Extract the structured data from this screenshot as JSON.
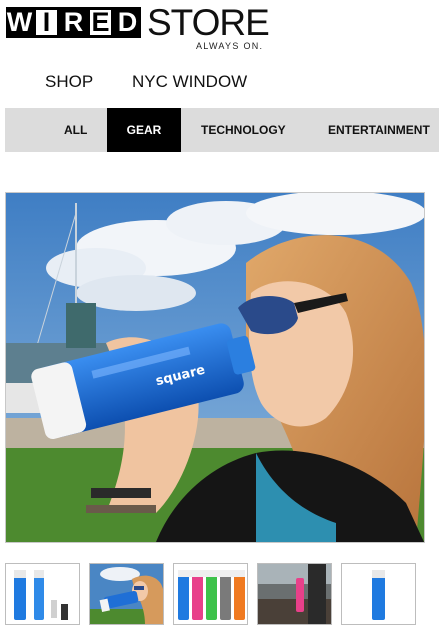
{
  "brand": {
    "logo_letters": [
      "W",
      "I",
      "R",
      "E",
      "D"
    ],
    "store": "STORE",
    "tagline": "ALWAYS ON."
  },
  "main_nav": [
    {
      "label": "SHOP"
    },
    {
      "label": "NYC WINDOW"
    }
  ],
  "category_tabs": [
    {
      "label": "ALL",
      "active": false
    },
    {
      "label": "GEAR",
      "active": true
    },
    {
      "label": "TECHNOLOGY",
      "active": false
    },
    {
      "label": "ENTERTAINMENT",
      "active": false
    }
  ],
  "product": {
    "bottle_brand": "square"
  },
  "thumbnails": [
    {
      "name": "bottles-lineup"
    },
    {
      "name": "woman-drinking"
    },
    {
      "name": "color-variants"
    },
    {
      "name": "bottle-outdoor"
    },
    {
      "name": "single-bottle"
    }
  ],
  "colors": {
    "accent_active": "#000000",
    "tab_bar_bg": "#dcdcdc",
    "bottle_blue": "#1f6fd6"
  }
}
